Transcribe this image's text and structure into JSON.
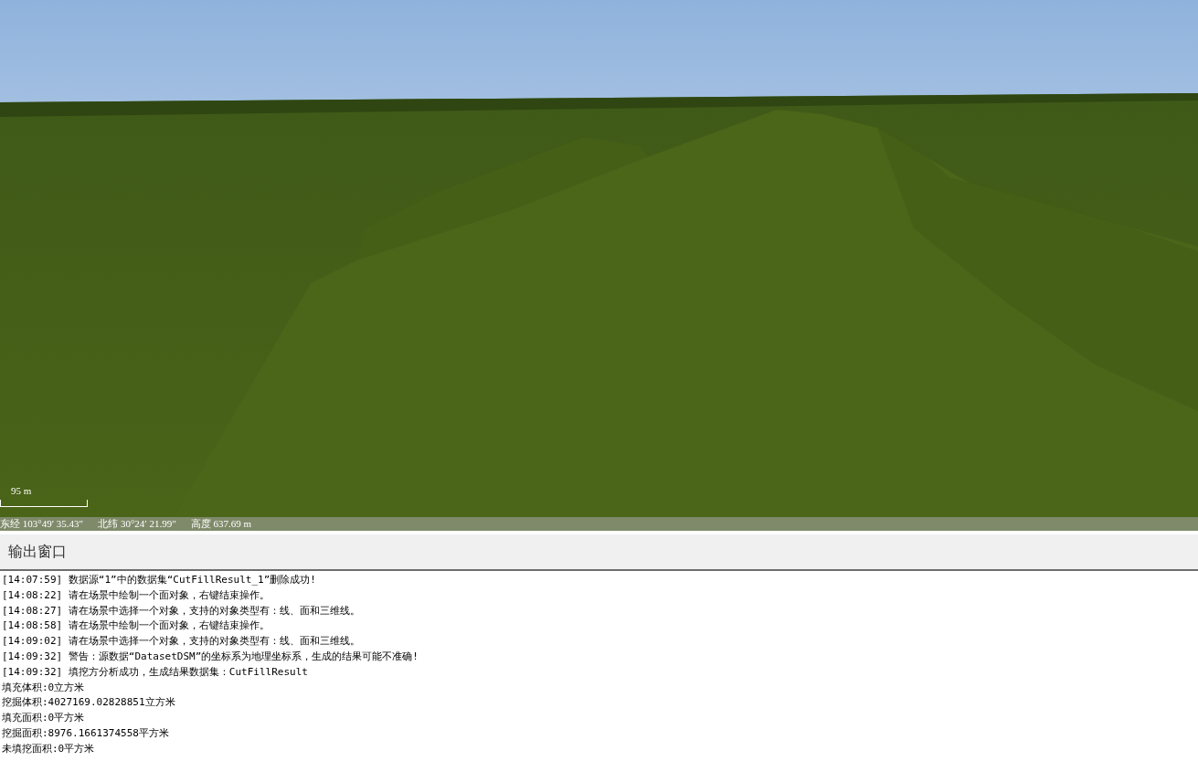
{
  "scene": {
    "scale_bar": {
      "label": "95 m"
    },
    "status_bar": [
      "东经 103°49′ 35.43″",
      "北纬 30°24′ 21.99″",
      "高度 637.69 m"
    ]
  },
  "output_window": {
    "title": "输出窗口",
    "lines": [
      "[14:07:59] 数据源“1”中的数据集“CutFillResult_1”删除成功!",
      "[14:08:22] 请在场景中绘制一个面对象，右键结束操作。",
      "[14:08:27] 请在场景中选择一个对象，支持的对象类型有：线、面和三维线。",
      "[14:08:58] 请在场景中绘制一个面对象，右键结束操作。",
      "[14:09:02] 请在场景中选择一个对象，支持的对象类型有：线、面和三维线。",
      "[14:09:32] 警告：源数据“DatasetDSM”的坐标系为地理坐标系，生成的结果可能不准确!",
      "[14:09:32] 填挖方分析成功，生成结果数据集：CutFillResult",
      "填充体积:0立方米",
      "挖掘体积:4027169.02828851立方米",
      "填充面积:0平方米",
      "挖掘面积:8976.1661374558平方米",
      "未填挖面积:0平方米"
    ]
  }
}
